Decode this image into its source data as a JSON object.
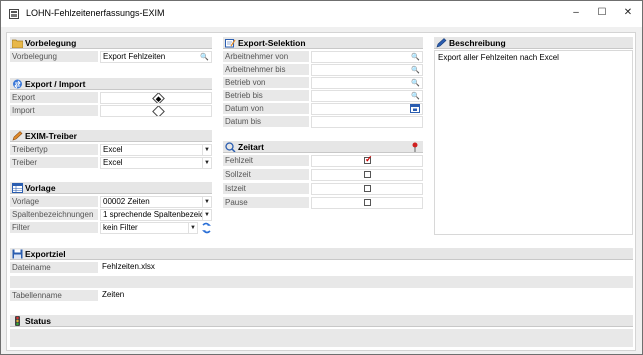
{
  "window": {
    "title": "LOHN-Fehlzeitenerfassungs-EXIM",
    "minimize": "–",
    "maximize": "☐",
    "close": "✕"
  },
  "vorbelegung": {
    "header": "Vorbelegung",
    "label": "Vorbelegung",
    "value": "Export Fehlzeiten"
  },
  "export_import": {
    "header": "Export / Import",
    "export_label": "Export",
    "import_label": "Import",
    "selected": "Export"
  },
  "exim_treiber": {
    "header": "EXIM-Treiber",
    "treibertyp_label": "Treibertyp",
    "treibertyp_value": "Excel",
    "treiber_label": "Treiber",
    "treiber_value": "Excel"
  },
  "vorlage": {
    "header": "Vorlage",
    "vorlage_label": "Vorlage",
    "vorlage_value": "00002 Zeiten",
    "spalten_label": "Spaltenbezeichnungen",
    "spalten_value": "1 sprechende Spaltenbezeid",
    "filter_label": "Filter",
    "filter_value": "kein Filter"
  },
  "export_selektion": {
    "header": "Export-Selektion",
    "rows": [
      {
        "label": "Arbeitnehmer von",
        "value": ""
      },
      {
        "label": "Arbeitnehmer bis",
        "value": ""
      },
      {
        "label": "Betrieb von",
        "value": ""
      },
      {
        "label": "Betrieb bis",
        "value": ""
      },
      {
        "label": "Datum von",
        "value": ""
      },
      {
        "label": "Datum bis",
        "value": ""
      }
    ]
  },
  "zeitart": {
    "header": "Zeitart",
    "rows": [
      {
        "label": "Fehlzeit",
        "checked": true
      },
      {
        "label": "Sollzeit",
        "checked": false
      },
      {
        "label": "Istzeit",
        "checked": false
      },
      {
        "label": "Pause",
        "checked": false
      }
    ]
  },
  "beschreibung": {
    "header": "Beschreibung",
    "text": "Export aller Fehlzeiten nach Excel"
  },
  "exportziel": {
    "header": "Exportziel",
    "dateiname_label": "Dateiname",
    "dateiname_value": "Fehlzeiten.xlsx",
    "tabellenname_label": "Tabellenname",
    "tabellenname_value": "Zeiten"
  },
  "status": {
    "header": "Status"
  },
  "colors": {
    "accent": "#1f5fbf",
    "header_bg": "#e6e6e6",
    "label_bg": "#e8e8e8"
  }
}
